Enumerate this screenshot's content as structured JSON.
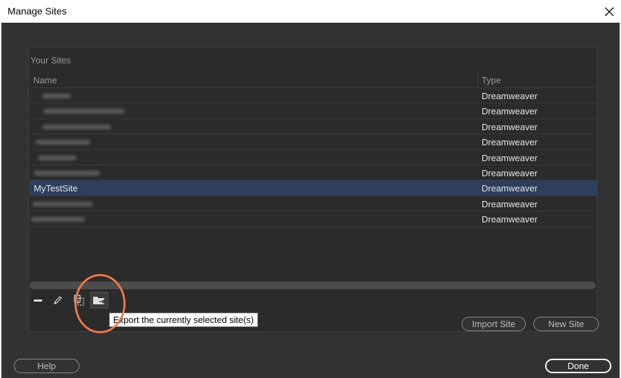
{
  "window": {
    "title": "Manage Sites"
  },
  "section": {
    "label": "Your Sites"
  },
  "table": {
    "columns": [
      "Name",
      "Type"
    ],
    "rows": [
      {
        "name": "",
        "type": "Dreamweaver",
        "selected": false
      },
      {
        "name": "",
        "type": "Dreamweaver",
        "selected": false
      },
      {
        "name": "",
        "type": "Dreamweaver",
        "selected": false
      },
      {
        "name": "",
        "type": "Dreamweaver",
        "selected": false
      },
      {
        "name": "",
        "type": "Dreamweaver",
        "selected": false
      },
      {
        "name": "",
        "type": "Dreamweaver",
        "selected": false
      },
      {
        "name": "MyTestSite",
        "type": "Dreamweaver",
        "selected": true
      },
      {
        "name": "",
        "type": "Dreamweaver",
        "selected": false
      },
      {
        "name": "",
        "type": "Dreamweaver",
        "selected": false
      }
    ]
  },
  "toolbar": {
    "icons": [
      "minus-icon",
      "pencil-icon",
      "duplicate-icon",
      "export-folder-icon"
    ],
    "tooltip": "Export the currently selected site(s)"
  },
  "buttons": {
    "import": "Import Site",
    "new": "New Site",
    "help": "Help",
    "done": "Done"
  },
  "colors": {
    "selected_row": "#2d3f5c",
    "annotation": "#f0784a"
  }
}
